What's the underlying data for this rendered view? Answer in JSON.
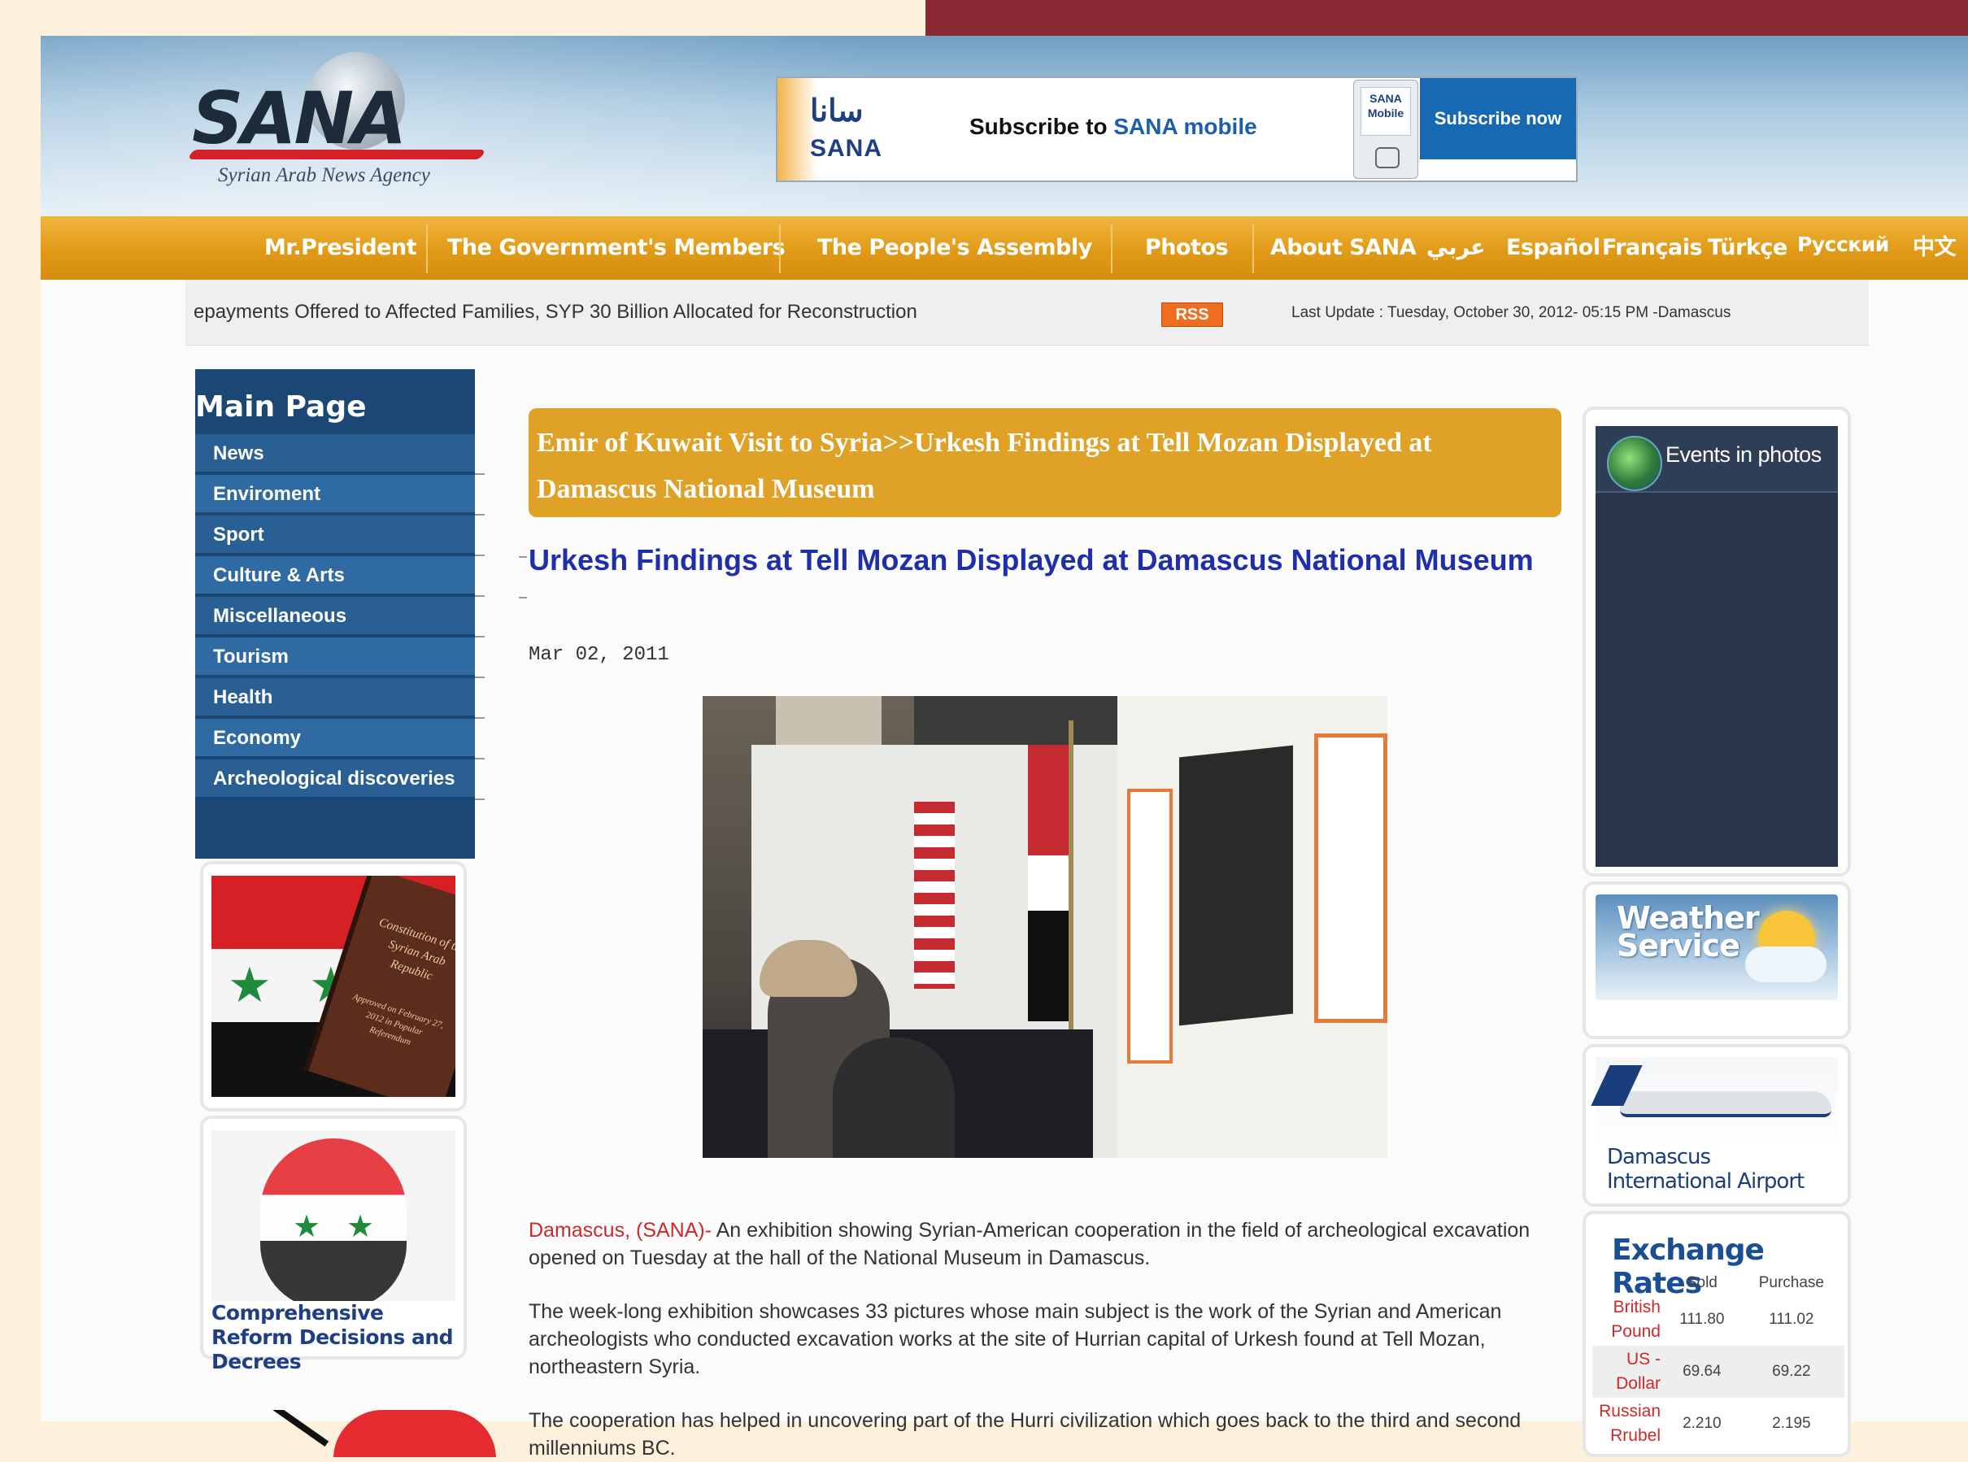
{
  "header": {
    "logo_text": "SANA",
    "logo_subtitle": "Syrian Arab News Agency",
    "banner": {
      "arabic_logo": "سانا",
      "logo_sana": "SANA",
      "text_prefix": "Subscribe to ",
      "text_highlight": "SANA mobile",
      "phone_label": "SANA Mobile",
      "button_label": "Subscribe now"
    }
  },
  "nav": {
    "items": [
      "Mr.President",
      "The Government's Members",
      "The People's Assembly",
      "Photos",
      "About SANA"
    ],
    "languages": [
      "عربي",
      "Español",
      "Français",
      "Türkçe",
      "Русский",
      "中文"
    ]
  },
  "ticker": {
    "text": "epayments Offered to Affected Families, SYP 30 Billion Allocated for Reconstruction",
    "rss_label": "RSS",
    "last_update": "Last Update : Tuesday, October 30, 2012- 05:15 PM -Damascus"
  },
  "sidebar": {
    "title": "Main Page",
    "items": [
      "News",
      "Enviroment",
      "Sport",
      "Culture & Arts",
      "Miscellaneous",
      "Tourism",
      "Health",
      "Economy",
      "Archeological discoveries"
    ],
    "constitution_book_title": "Constitution of the Syrian Arab Republic",
    "constitution_book_sub": "Approved on February 27, 2012 in Popular Referendum",
    "reform_caption": "Comprehensive Reform Decisions and Decrees"
  },
  "main": {
    "headline": "Emir of Kuwait Visit to Syria>>Urkesh Findings at Tell Mozan Displayed at Damascus National Museum",
    "article_title": "Urkesh Findings at Tell Mozan Displayed at Damascus National Museum",
    "date": "Mar 02, 2011",
    "para1_lead": "Damascus, (SANA)-",
    "para1_rest": " An exhibition showing Syrian-American cooperation in the field of archeological excavation opened on Tuesday at the hall of the National Museum in Damascus.",
    "para2": "The week-long exhibition showcases 33 pictures whose main subject is the work of the Syrian and American archeologists who conducted excavation works at the site of Hurrian capital of Urkesh found at Tell Mozan, northeastern Syria.",
    "para3": "The cooperation has helped in uncovering part of the Hurri civilization which goes back to the third and second millenniums BC."
  },
  "right": {
    "events_title": "Events in photos",
    "weather_line1": "Weather",
    "weather_line2": "Service",
    "airport_text": "Damascus International Airport",
    "exchange": {
      "title": "Exchange Rates",
      "col_sold": "Sold",
      "col_purchase": "Purchase",
      "rows": [
        {
          "name": "British Pound",
          "sold": "111.80",
          "purchase": "111.02"
        },
        {
          "name": "US - Dollar",
          "sold": "69.64",
          "purchase": "69.22"
        },
        {
          "name": "Russian Rrubel",
          "sold": "2.210",
          "purchase": "2.195"
        }
      ]
    }
  },
  "colors": {
    "nav_orange": "#e19a17",
    "menu_blue": "#1a4773",
    "headline_gold": "#dfa227",
    "title_blue": "#1f2faa",
    "accent_red": "#c92a2a",
    "top_band": "#8a2a35"
  }
}
